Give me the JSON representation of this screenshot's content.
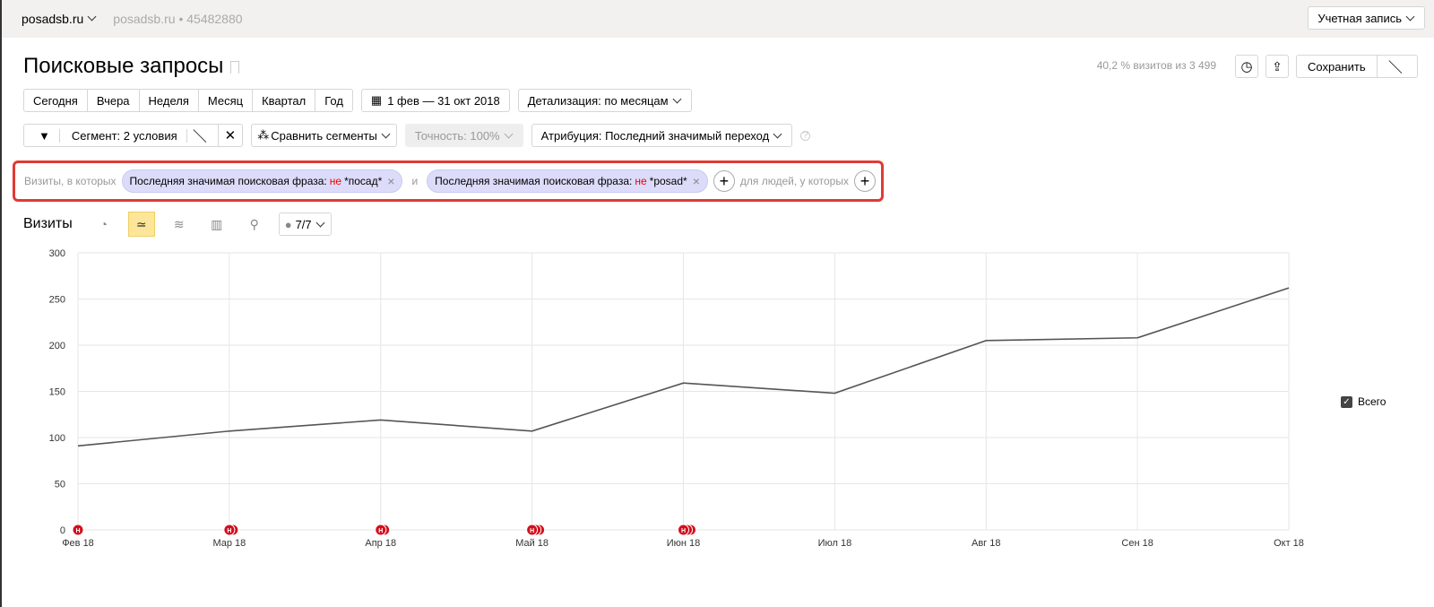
{
  "topbar": {
    "site": "posadsb.ru",
    "counter_site": "posadsb.ru",
    "counter_sep": "•",
    "counter_id": "45482880",
    "account": "Учетная запись"
  },
  "header": {
    "title": "Поисковые запросы",
    "visits_info": "40,2 % визитов из 3 499",
    "save": "Сохранить"
  },
  "periods": [
    "Сегодня",
    "Вчера",
    "Неделя",
    "Месяц",
    "Квартал",
    "Год"
  ],
  "date_range": "1 фев — 31 окт 2018",
  "detail": "Детализация: по месяцам",
  "segment": "Сегмент: 2 условия",
  "compare": "Сравнить сегменты",
  "accuracy": "Точность: 100%",
  "attribution": "Атрибуция: Последний значимый переход",
  "filter": {
    "prefix": "Визиты, в которых",
    "conditions": [
      {
        "field": "Последняя значимая поисковая фраза:",
        "op": "не",
        "value": "*посад*"
      },
      {
        "field": "Последняя значимая поисковая фраза:",
        "op": "не",
        "value": "*posad*"
      }
    ],
    "joiner": "и",
    "people": "для людей, у которых"
  },
  "chart_toolbar": {
    "title": "Визиты",
    "annotations": "7/7"
  },
  "colors": {
    "line": "#555555",
    "marker": "#d40f1d",
    "highlight": "#e03a34"
  },
  "chart_data": {
    "type": "line",
    "categories": [
      "Фев 18",
      "Мар 18",
      "Апр 18",
      "Май 18",
      "Июн 18",
      "Июл 18",
      "Авг 18",
      "Сен 18",
      "Окт 18"
    ],
    "series": [
      {
        "name": "Всего",
        "values": [
          91,
          107,
          119,
          107,
          159,
          148,
          205,
          208,
          262
        ]
      }
    ],
    "ylim": [
      0,
      300
    ],
    "yticks": [
      0,
      50,
      100,
      150,
      200,
      250,
      300
    ],
    "annotation_counts": [
      1,
      2,
      2,
      3,
      3,
      0,
      0,
      0,
      0
    ],
    "annotation_label": "Н",
    "legend": "right"
  }
}
